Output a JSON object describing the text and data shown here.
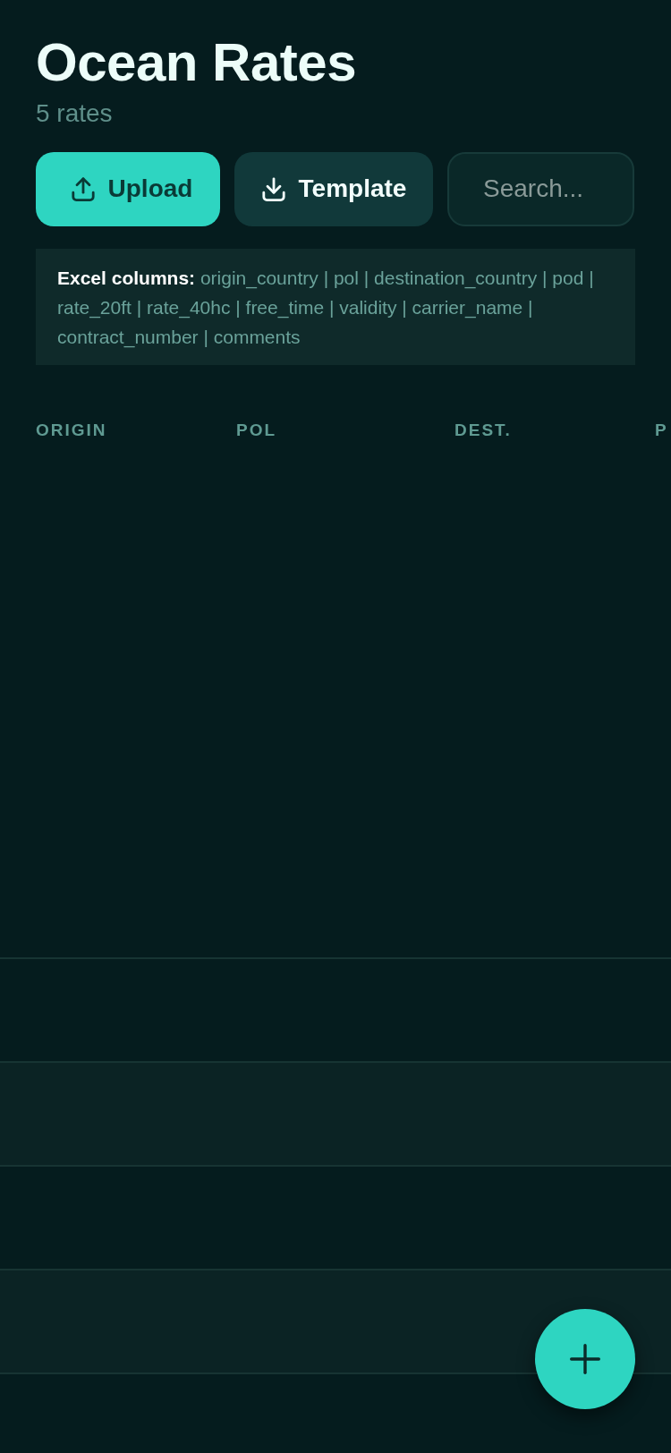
{
  "header": {
    "title": "Ocean Rates",
    "subtitle": "5 rates"
  },
  "actions": [
    {
      "kind": "upload",
      "label": "Upload"
    },
    {
      "kind": "download",
      "label": "Template"
    }
  ],
  "search": {
    "placeholder": "Search..."
  },
  "excel_note": "**Excel columns:** origin_country | pol | destination_country | pod | rate_20ft | rate_40hc | free_time | validity | carrier_name | contract_number | comments",
  "table": {
    "columns": [
      "ORIGIN",
      "POL",
      "DEST.",
      "P"
    ]
  }
}
